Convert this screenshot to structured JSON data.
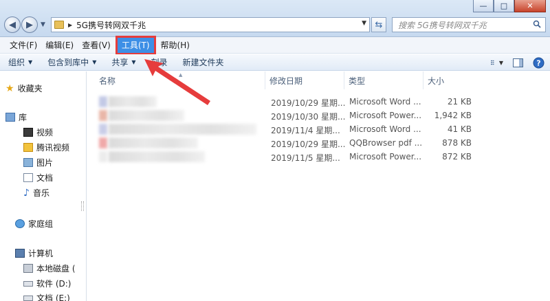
{
  "window": {
    "minimize_label": "—",
    "maximize_label": "□",
    "close_label": "✕"
  },
  "nav": {
    "back_label": "◀",
    "forward_label": "▶"
  },
  "address": {
    "path": "5G携号转网双千兆"
  },
  "search": {
    "placeholder": "搜索 5G携号转网双千兆"
  },
  "menu": {
    "items": [
      {
        "label": "文件(F)"
      },
      {
        "label": "编辑(E)"
      },
      {
        "label": "查看(V)"
      },
      {
        "label": "工具(T)"
      },
      {
        "label": "帮助(H)"
      }
    ]
  },
  "toolbar": {
    "organize": "组织",
    "include_library": "包含到库中",
    "share": "共享",
    "burn": "刻录",
    "new_folder": "新建文件夹"
  },
  "sidebar": {
    "favorites": "收藏夹",
    "library": "库",
    "library_items": [
      "视频",
      "腾讯视频",
      "图片",
      "文档",
      "音乐"
    ],
    "homegroup": "家庭组",
    "computer": "计算机",
    "drives": [
      "本地磁盘 (",
      "软件 (D:)",
      "文档 (E:)"
    ]
  },
  "columns": {
    "name": "名称",
    "modified": "修改日期",
    "type": "类型",
    "size": "大小"
  },
  "files": [
    {
      "modified": "2019/10/29 星期...",
      "type": "Microsoft Word ...",
      "size": "21 KB"
    },
    {
      "modified": "2019/10/30 星期...",
      "type": "Microsoft Power...",
      "size": "1,942 KB"
    },
    {
      "modified": "2019/11/4 星期...",
      "type": "Microsoft Word ...",
      "size": "41 KB"
    },
    {
      "modified": "2019/10/29 星期...",
      "type": "QQBrowser pdf ...",
      "size": "878 KB"
    },
    {
      "modified": "2019/11/5 星期...",
      "type": "Microsoft Power...",
      "size": "872 KB"
    }
  ],
  "colors": {
    "menu_highlight": "#3d8fe6",
    "annotation_red": "#e63c3c"
  }
}
